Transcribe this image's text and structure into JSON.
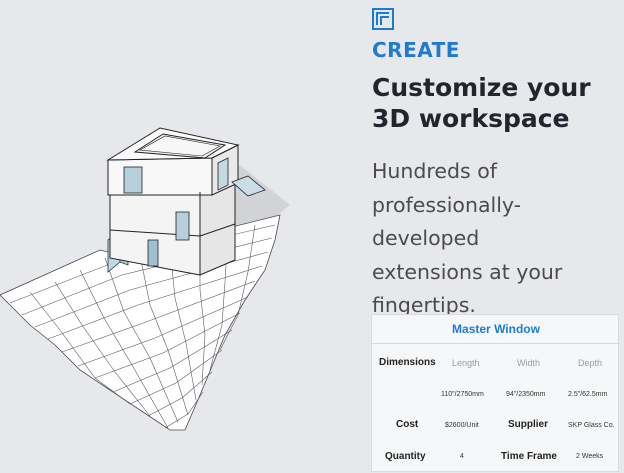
{
  "hero": {
    "eyebrow": "CREATE",
    "headline": "Customize your 3D workspace",
    "subhead": "Hundreds of\nprofessionally-developed\nextensions at your\nfingertips."
  },
  "icons": {
    "brand": "corner-frame-logo-icon",
    "illustration": "3d-building-model-illustration"
  },
  "colors": {
    "accent": "#1e7bd3",
    "headline": "#22242e",
    "background": "#e7e8ec",
    "card": "#f6f7f8"
  },
  "spec_card": {
    "title": "Master Window",
    "dimensions": {
      "label": "Dimensions",
      "columns": [
        "Length",
        "Width",
        "Depth"
      ],
      "values": [
        "110\"/2750mm",
        "94\"/2350mm",
        "2.5\"/62.5mm"
      ]
    },
    "cost": {
      "label": "Cost",
      "value": "$2600/Unit"
    },
    "supplier": {
      "label": "Supplier",
      "value": "SKP Glass Co."
    },
    "quantity": {
      "label": "Quantity",
      "value": "4"
    },
    "time_frame": {
      "label": "Time Frame",
      "value": "2 Weeks"
    }
  }
}
